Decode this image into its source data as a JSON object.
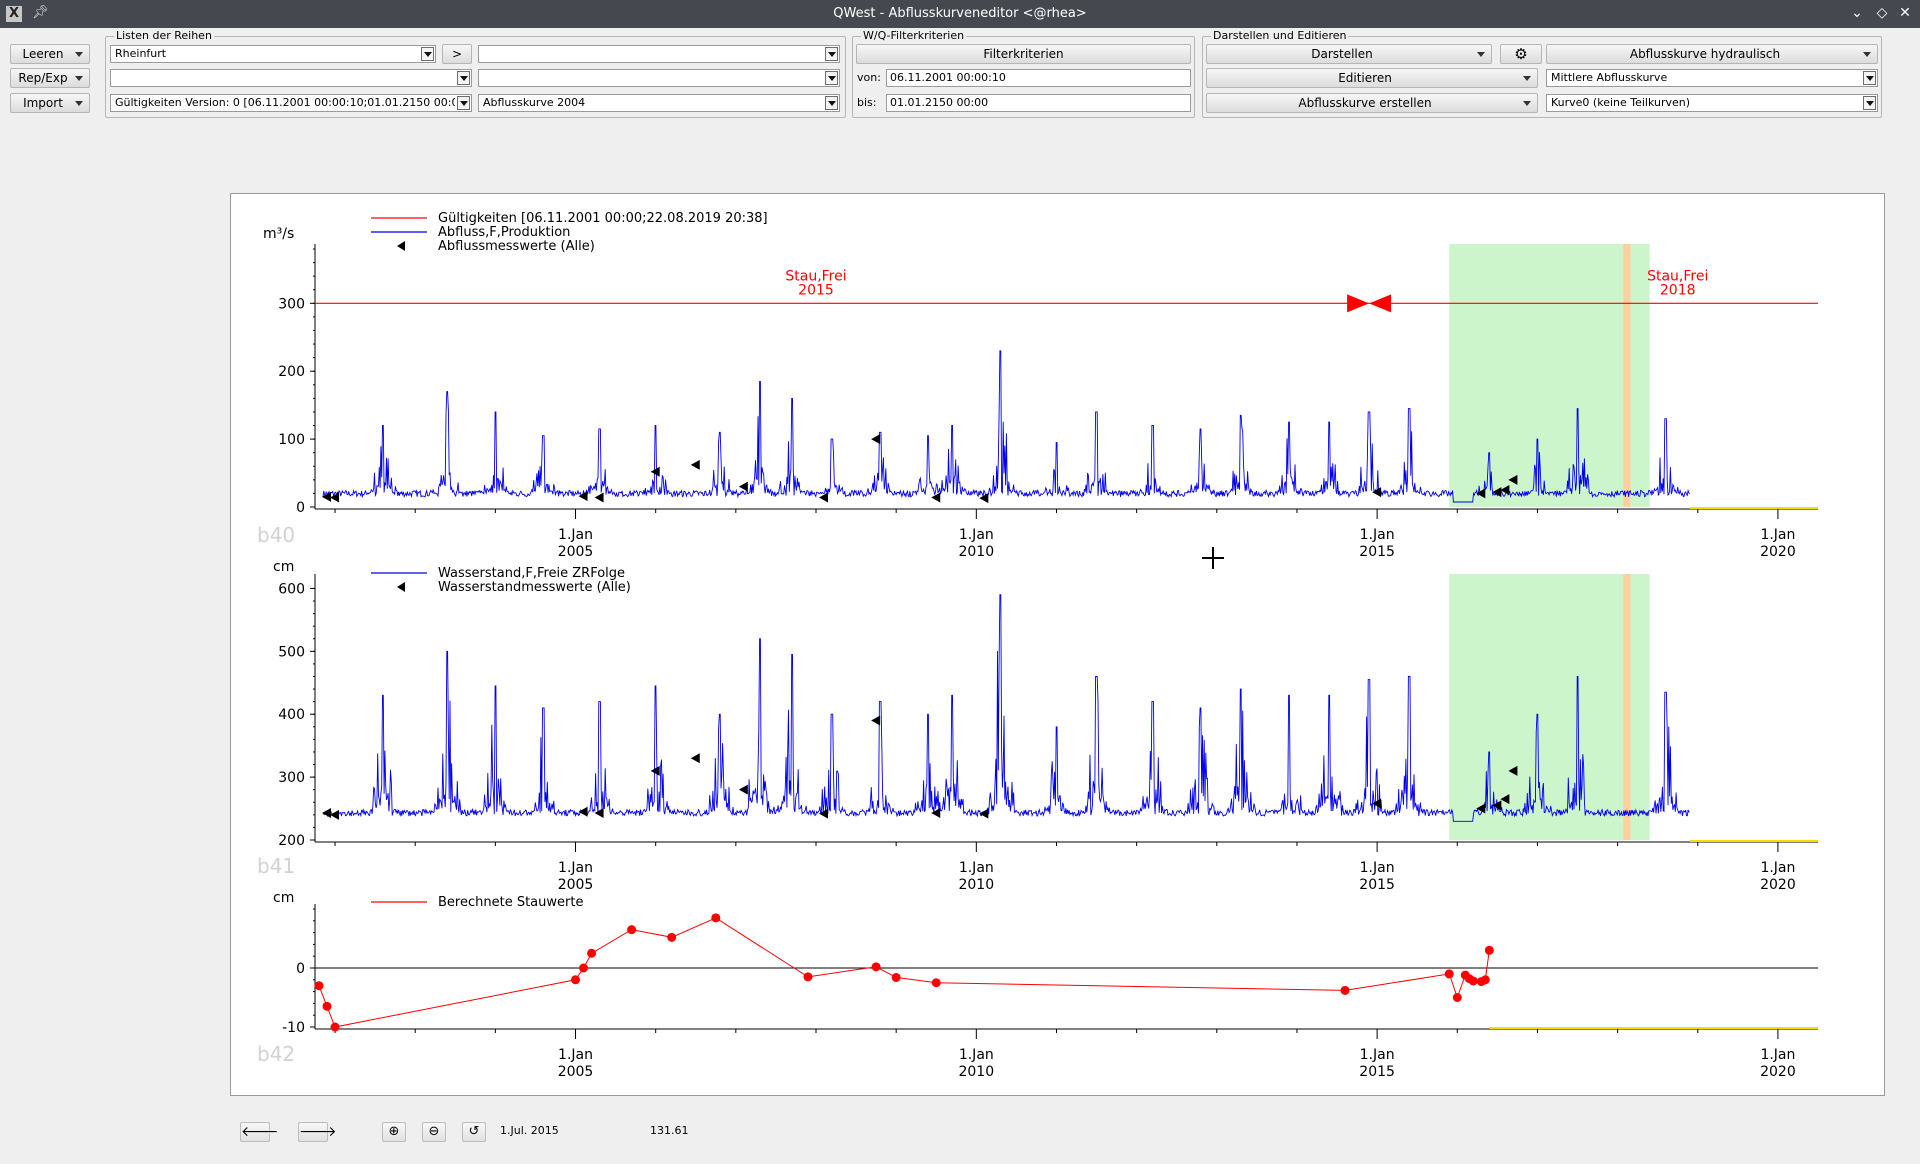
{
  "window": {
    "title": "QWest - Abflusskurveneditor <@rhea>",
    "app_icon": "X"
  },
  "toolbar_left": {
    "leeren": "Leeren",
    "rep_exp": "Rep/Exp",
    "import": "Import"
  },
  "listen": {
    "group_title": "Listen der Reihen",
    "reihe1": "Rheinfurt",
    "forward": ">",
    "reihe2": "",
    "reihe3": "",
    "reihe4": "",
    "gueltigkeiten": "Gültigkeiten Version:  0 [06.11.2001 00:00:10;01.01.2150 00:00",
    "abflusskurve": "Abflusskurve 2004"
  },
  "filter": {
    "group_title": "W/Q-Filterkriterien",
    "button": "Filterkriterien",
    "von_label": "von:",
    "von_value": "06.11.2001 00:00:10",
    "bis_label": "bis:",
    "bis_value": "01.01.2150 00:00"
  },
  "darstellen": {
    "group_title": "Darstellen und Editieren",
    "darstellen": "Darstellen",
    "editieren": "Editieren",
    "erstellen": "Abflusskurve erstellen",
    "hydraulisch": "Abflusskurve hydraulisch",
    "mittlere": "Mittlere Abflusskurve",
    "kurve0": "Kurve0 (keine Teilkurven)"
  },
  "status": {
    "date": "1.Jul. 2015",
    "value": "131.61"
  },
  "colors": {
    "series": "#0000ee",
    "valid": "#ff0000",
    "stau": "#ff0000",
    "highlight": "#ccf5cc",
    "band": "#ffcfa0"
  },
  "chart_data": [
    {
      "type": "line",
      "id": "b40",
      "unit": "m³/s",
      "ylim": [
        0,
        380
      ],
      "yticks": [
        0,
        100,
        200,
        300
      ],
      "xlim": [
        2001.75,
        2020.5
      ],
      "xticks": [
        {
          "year": 2005,
          "line1": "1.Jan",
          "line2": "2005"
        },
        {
          "year": 2010,
          "line1": "1.Jan",
          "line2": "2010"
        },
        {
          "year": 2015,
          "line1": "1.Jan",
          "line2": "2015"
        },
        {
          "year": 2020,
          "line1": "1.Jan",
          "line2": "2020"
        }
      ],
      "legend": [
        {
          "name": "Gültigkeiten [06.11.2001 00:00;22.08.2019 20:38]",
          "style": "line",
          "color": "#ff0000"
        },
        {
          "name": "Abfluss,F,Produktion",
          "style": "line",
          "color": "#0000ee"
        },
        {
          "name": "Abflussmesswerte (Alle)",
          "style": "marker",
          "color": "#000000"
        }
      ],
      "validity_level": 300,
      "annotations": [
        {
          "line1": "Stau,Frei",
          "line2": "2015",
          "x": 2008.0
        },
        {
          "line1": "Stau,Frei",
          "line2": "2018",
          "x": 2018.75
        }
      ],
      "bowtie_x": 2014.9,
      "highlight_range": [
        2015.9,
        2018.4
      ],
      "band_range": [
        2018.07,
        2018.16
      ],
      "series_range": [
        2001.85,
        2018.9
      ],
      "base": 15,
      "peaks": [
        [
          2002.6,
          120
        ],
        [
          2003.4,
          170
        ],
        [
          2004.0,
          140
        ],
        [
          2004.6,
          105
        ],
        [
          2005.3,
          115
        ],
        [
          2006.0,
          120
        ],
        [
          2006.8,
          110
        ],
        [
          2007.3,
          185
        ],
        [
          2007.7,
          160
        ],
        [
          2008.2,
          100
        ],
        [
          2008.8,
          110
        ],
        [
          2009.4,
          105
        ],
        [
          2009.7,
          120
        ],
        [
          2010.3,
          230
        ],
        [
          2011.0,
          95
        ],
        [
          2011.5,
          140
        ],
        [
          2012.2,
          120
        ],
        [
          2012.8,
          115
        ],
        [
          2013.3,
          135
        ],
        [
          2013.9,
          125
        ],
        [
          2014.4,
          125
        ],
        [
          2014.9,
          140
        ],
        [
          2015.4,
          145
        ],
        [
          2016.4,
          80
        ],
        [
          2017.0,
          100
        ],
        [
          2017.5,
          145
        ],
        [
          2018.6,
          130
        ]
      ],
      "measurements": [
        [
          2001.9,
          15
        ],
        [
          2002.0,
          14
        ],
        [
          2005.1,
          16
        ],
        [
          2005.3,
          14
        ],
        [
          2006.0,
          52
        ],
        [
          2006.5,
          62
        ],
        [
          2007.1,
          30
        ],
        [
          2008.1,
          14
        ],
        [
          2008.75,
          100
        ],
        [
          2009.5,
          14
        ],
        [
          2010.1,
          13
        ],
        [
          2015.0,
          22
        ],
        [
          2016.3,
          20
        ],
        [
          2016.5,
          22
        ],
        [
          2016.6,
          25
        ],
        [
          2016.7,
          40
        ]
      ]
    },
    {
      "type": "line",
      "id": "b41",
      "unit": "cm",
      "ylim": [
        200,
        615
      ],
      "yticks": [
        200,
        300,
        400,
        500,
        600
      ],
      "xlim": [
        2001.75,
        2020.5
      ],
      "xticks": [
        {
          "year": 2005,
          "line1": "1.Jan",
          "line2": "2005"
        },
        {
          "year": 2010,
          "line1": "1.Jan",
          "line2": "2010"
        },
        {
          "year": 2015,
          "line1": "1.Jan",
          "line2": "2015"
        },
        {
          "year": 2020,
          "line1": "1.Jan",
          "line2": "2020"
        }
      ],
      "legend": [
        {
          "name": "Wasserstand,F,Freie ZRFolge",
          "style": "line",
          "color": "#0000ee"
        },
        {
          "name": "Wasserstandmesswerte (Alle)",
          "style": "marker",
          "color": "#000000"
        }
      ],
      "highlight_range": [
        2015.9,
        2018.4
      ],
      "band_range": [
        2018.07,
        2018.16
      ],
      "series_range": [
        2001.85,
        2018.9
      ],
      "base": 238,
      "peaks": [
        [
          2002.6,
          430
        ],
        [
          2003.4,
          500
        ],
        [
          2004.0,
          445
        ],
        [
          2004.6,
          410
        ],
        [
          2005.3,
          420
        ],
        [
          2006.0,
          445
        ],
        [
          2006.8,
          400
        ],
        [
          2007.3,
          520
        ],
        [
          2007.7,
          495
        ],
        [
          2008.2,
          400
        ],
        [
          2008.8,
          420
        ],
        [
          2009.4,
          400
        ],
        [
          2009.7,
          430
        ],
        [
          2010.3,
          590
        ],
        [
          2011.0,
          380
        ],
        [
          2011.5,
          460
        ],
        [
          2012.2,
          420
        ],
        [
          2012.8,
          410
        ],
        [
          2013.3,
          440
        ],
        [
          2013.9,
          430
        ],
        [
          2014.4,
          430
        ],
        [
          2014.9,
          455
        ],
        [
          2015.4,
          460
        ],
        [
          2016.4,
          340
        ],
        [
          2017.0,
          400
        ],
        [
          2017.5,
          460
        ],
        [
          2018.6,
          435
        ]
      ],
      "measurements": [
        [
          2001.9,
          243
        ],
        [
          2002.0,
          240
        ],
        [
          2005.1,
          245
        ],
        [
          2005.3,
          243
        ],
        [
          2006.0,
          310
        ],
        [
          2006.5,
          330
        ],
        [
          2007.1,
          280
        ],
        [
          2008.1,
          242
        ],
        [
          2008.75,
          390
        ],
        [
          2009.5,
          243
        ],
        [
          2010.1,
          242
        ],
        [
          2015.0,
          258
        ],
        [
          2016.3,
          250
        ],
        [
          2016.5,
          255
        ],
        [
          2016.6,
          265
        ],
        [
          2016.7,
          310
        ]
      ]
    },
    {
      "type": "line",
      "id": "b42",
      "unit": "cm",
      "ylim": [
        -10,
        10
      ],
      "yticks": [
        -10,
        0
      ],
      "xlim": [
        2001.75,
        2020.5
      ],
      "xticks": [
        {
          "year": 2005,
          "line1": "1.Jan",
          "line2": "2005"
        },
        {
          "year": 2010,
          "line1": "1.Jan",
          "line2": "2010"
        },
        {
          "year": 2015,
          "line1": "1.Jan",
          "line2": "2015"
        },
        {
          "year": 2020,
          "line1": "1.Jan",
          "line2": "2020"
        }
      ],
      "legend": [
        {
          "name": "Berechnete Stauwerte",
          "style": "line",
          "color": "#ff0000"
        }
      ],
      "x": [
        2001.8,
        2001.9,
        2002.0,
        2005.0,
        2005.1,
        2005.2,
        2005.7,
        2006.2,
        2006.75,
        2007.9,
        2008.75,
        2009.0,
        2009.5,
        2014.6,
        2015.9,
        2016.0,
        2016.1,
        2016.15,
        2016.2,
        2016.3,
        2016.35,
        2016.4
      ],
      "values": [
        -3,
        -6.5,
        -10,
        -2,
        0,
        2.5,
        6.5,
        5.2,
        8.5,
        -1.5,
        0.2,
        -1.6,
        -2.5,
        -3.8,
        -1,
        -5,
        -1.2,
        -1.8,
        -2.2,
        -2.3,
        -2,
        3
      ]
    }
  ]
}
